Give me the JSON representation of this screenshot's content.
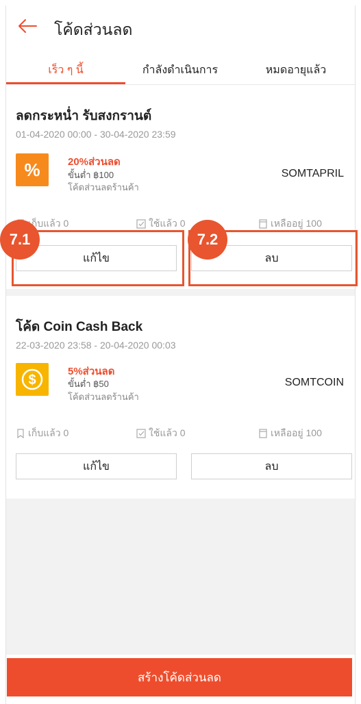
{
  "header": {
    "title": "โค้ดส่วนลด",
    "back_icon": "arrow-left-icon"
  },
  "tabs": [
    {
      "label": "เร็ว ๆ นี้",
      "active": true
    },
    {
      "label": "กำลังดำเนินการ",
      "active": false
    },
    {
      "label": "หมดอายุแล้ว",
      "active": false
    }
  ],
  "vouchers": [
    {
      "title": "ลดกระหน่ำ รับสงกรานต์",
      "period": "01-04-2020 00:00 - 30-04-2020 23:59",
      "icon": "percent-icon",
      "icon_symbol": "%",
      "discount": "20%ส่วนลด",
      "min_spend": "ขั้นต่ำ ฿100",
      "type": "โค้ดส่วนลดร้านค้า",
      "code": "SOMTAPRIL",
      "collected": "เก็บแล้ว 0",
      "used": "ใช้แล้ว 0",
      "remaining": "เหลืออยู่ 100",
      "edit_label": "แก้ไข",
      "delete_label": "ลบ"
    },
    {
      "title": "โค้ด Coin Cash Back",
      "period": "22-03-2020 23:58 - 20-04-2020 00:03",
      "icon": "coin-dollar-icon",
      "icon_symbol": "$",
      "discount": "5%ส่วนลด",
      "min_spend": "ขั้นต่ำ ฿50",
      "type": "โค้ดส่วนลดร้านค้า",
      "code": "SOMTCOIN",
      "collected": "เก็บแล้ว 0",
      "used": "ใช้แล้ว 0",
      "remaining": "เหลืออยู่ 100",
      "edit_label": "แก้ไข",
      "delete_label": "ลบ"
    }
  ],
  "annotations": [
    {
      "label": "7.1"
    },
    {
      "label": "7.2"
    }
  ],
  "footer": {
    "create_label": "สร้างโค้ดส่วนลด"
  },
  "colors": {
    "accent": "#ee4d2d",
    "annotation": "#e8552f",
    "coin": "#f7b500"
  }
}
